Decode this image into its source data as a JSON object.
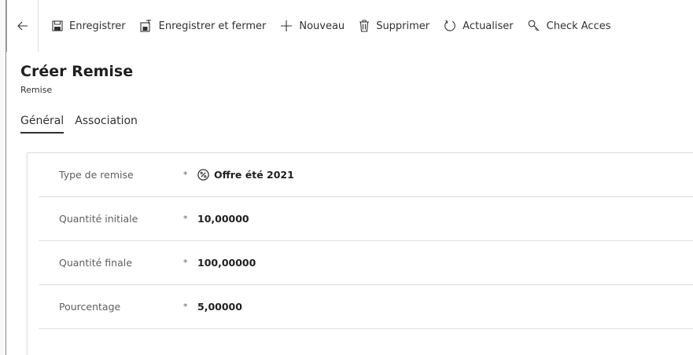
{
  "toolbar": {
    "back_icon": "arrow-left-icon",
    "commands": [
      {
        "label": "Enregistrer",
        "icon": "save-icon"
      },
      {
        "label": "Enregistrer et fermer",
        "icon": "save-close-icon"
      },
      {
        "label": "Nouveau",
        "icon": "plus-icon"
      },
      {
        "label": "Supprimer",
        "icon": "trash-icon"
      },
      {
        "label": "Actualiser",
        "icon": "refresh-icon"
      },
      {
        "label": "Check Acces",
        "icon": "key-icon"
      }
    ]
  },
  "form": {
    "title": "Créer Remise",
    "entity": "Remise",
    "tabs": [
      {
        "label": "Général",
        "active": true
      },
      {
        "label": "Association",
        "active": false
      }
    ],
    "fields": [
      {
        "label": "Type de remise",
        "required": "*",
        "value": "Offre été 2021",
        "icon": "discount-percent-icon"
      },
      {
        "label": "Quantité initiale",
        "required": "*",
        "value": "10,00000"
      },
      {
        "label": "Quantité finale",
        "required": "*",
        "value": "100,00000"
      },
      {
        "label": "Pourcentage",
        "required": "*",
        "value": "5,00000"
      }
    ]
  }
}
